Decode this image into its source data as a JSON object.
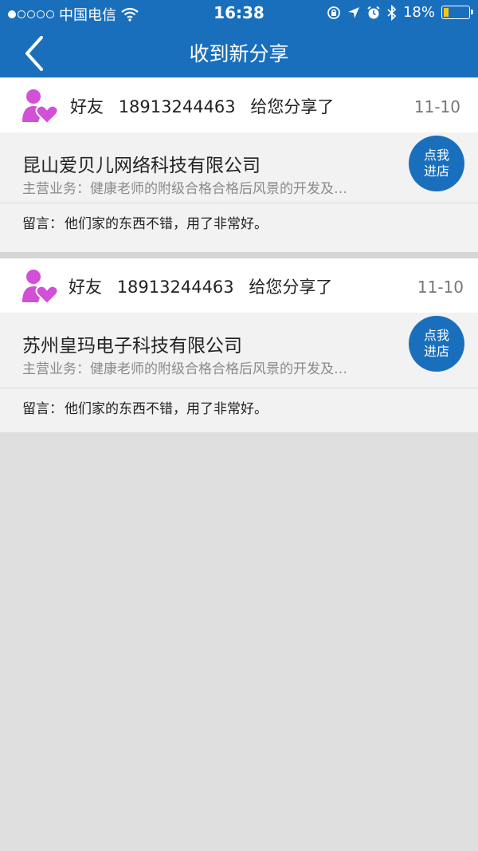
{
  "status_bar": {
    "carrier": "中国电信",
    "time": "16:38",
    "battery": "18%"
  },
  "header": {
    "title": "收到新分享"
  },
  "shares": [
    {
      "friend_label": "好友",
      "phone": "18913244463",
      "action": "给您分享了",
      "date": "11-10",
      "company": "昆山爱贝儿网络科技有限公司",
      "business": "主营业务：健康老师的附级合格合格后风景的开发及…",
      "visit_button": "点我\n进店",
      "message_label": "留言：",
      "message": "他们家的东西不错，用了非常好。"
    },
    {
      "friend_label": "好友",
      "phone": "18913244463",
      "action": "给您分享了",
      "date": "11-10",
      "company": "苏州皇玛电子科技有限公司",
      "business": "主营业务：健康老师的附级合格合格后风景的开发及…",
      "visit_button": "点我\n进店",
      "message_label": "留言：",
      "message": "他们家的东西不错，用了非常好。"
    }
  ],
  "colors": {
    "header_bg": "#1a6fbd",
    "accent": "#1a6fbd",
    "friend_icon": "#d24fd8",
    "page_bg": "#dedede"
  }
}
